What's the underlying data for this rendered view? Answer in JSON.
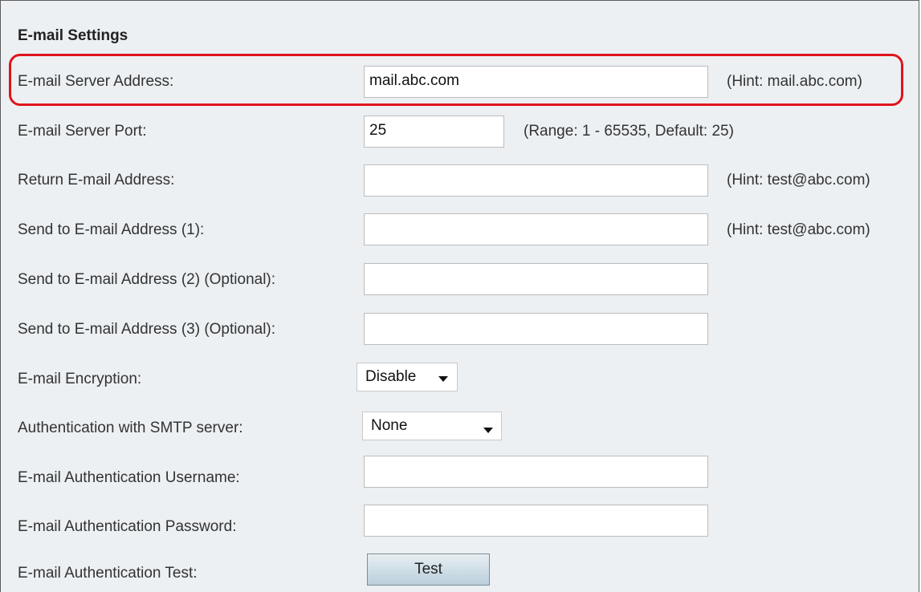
{
  "section_title": "E-mail Settings",
  "fields": {
    "server_address": {
      "label": "E-mail Server Address:",
      "value": "mail.abc.com",
      "hint": "(Hint: mail.abc.com)"
    },
    "server_port": {
      "label": "E-mail Server Port:",
      "value": "25",
      "hint": "(Range: 1 - 65535, Default: 25)"
    },
    "return_address": {
      "label": "Return E-mail Address:",
      "value": "",
      "hint": "(Hint: test@abc.com)"
    },
    "send_to_1": {
      "label": "Send to E-mail Address (1):",
      "value": "",
      "hint": "(Hint: test@abc.com)"
    },
    "send_to_2": {
      "label": "Send to E-mail Address (2) (Optional):",
      "value": ""
    },
    "send_to_3": {
      "label": "Send to E-mail Address (3) (Optional):",
      "value": ""
    },
    "encryption": {
      "label": "E-mail Encryption:",
      "selected": "Disable"
    },
    "smtp_auth": {
      "label": "Authentication with SMTP server:",
      "selected": "None"
    },
    "auth_username": {
      "label": "E-mail Authentication Username:",
      "value": ""
    },
    "auth_password": {
      "label": "E-mail Authentication Password:",
      "value": ""
    },
    "auth_test": {
      "label": "E-mail Authentication Test:",
      "button": "Test"
    }
  },
  "colors": {
    "panel_bg": "#ecf0f3",
    "highlight": "#e0141c"
  },
  "icons": {
    "dropdown": "chevron-down-icon"
  }
}
